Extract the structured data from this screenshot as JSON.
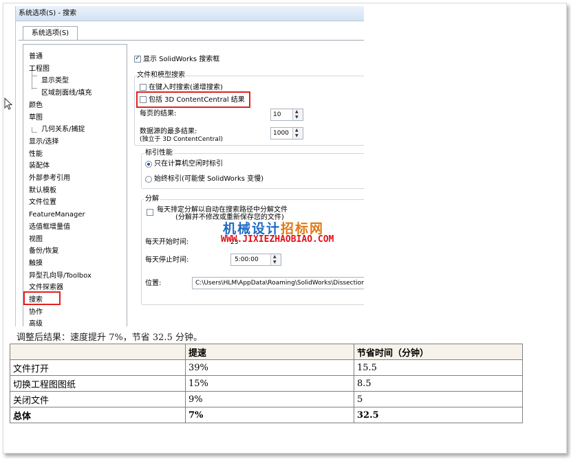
{
  "dialog": {
    "title": "系统选项(S) - 搜索",
    "tab_label": "系统选项(S)",
    "tree": [
      {
        "label": "普通",
        "level": 0
      },
      {
        "label": "工程图",
        "level": 0
      },
      {
        "label": "显示类型",
        "level": 1
      },
      {
        "label": "区域剖面线/填充",
        "level": 1
      },
      {
        "label": "颜色",
        "level": 0
      },
      {
        "label": "草图",
        "level": 0
      },
      {
        "label": "几何关系/捕捉",
        "level": 1
      },
      {
        "label": "显示/选择",
        "level": 0
      },
      {
        "label": "性能",
        "level": 0
      },
      {
        "label": "装配体",
        "level": 0
      },
      {
        "label": "外部参考引用",
        "level": 0
      },
      {
        "label": "默认模板",
        "level": 0
      },
      {
        "label": "文件位置",
        "level": 0
      },
      {
        "label": "FeatureManager",
        "level": 0
      },
      {
        "label": "选值框增量值",
        "level": 0
      },
      {
        "label": "视图",
        "level": 0
      },
      {
        "label": "备份/恢复",
        "level": 0
      },
      {
        "label": "触摸",
        "level": 0
      },
      {
        "label": "异型孔向导/Toolbox",
        "level": 0
      },
      {
        "label": "文件探索器",
        "level": 0
      },
      {
        "label": "搜索",
        "level": 0,
        "selected": true
      },
      {
        "label": "协作",
        "level": 0
      },
      {
        "label": "高级",
        "level": 0
      }
    ],
    "show_search_box": {
      "label": "显示 SolidWorks 搜索框",
      "checked": true
    },
    "file_model_search": {
      "title": "文件和模型搜索",
      "search_while_typing": {
        "label": "在键入时搜索(递增搜索)",
        "checked": false
      },
      "include_3d_content": {
        "label": "包括 3D ContentCentral 结果",
        "checked": false
      },
      "results_per_page": {
        "label": "每页的结果:",
        "value": "10"
      },
      "max_results": {
        "label": "数据源的最多结果:",
        "sublabel": "(独立于 3D ContentCentral)",
        "value": "1000"
      }
    },
    "index_performance": {
      "title": "标引性能",
      "options": [
        {
          "label": "只在计算机空闲时标引",
          "selected": true
        },
        {
          "label": "始终标引(可能使 SolidWorks 变慢)",
          "selected": false
        }
      ]
    },
    "decompose": {
      "title": "分解",
      "schedule": {
        "label": "每天排定分解以自动在搜索路径中分解文件",
        "sublabel": "(分解并不修改或重新保存您的文件)",
        "checked": false
      },
      "start_time": {
        "label": "每天开始时间:",
        "value": "23"
      },
      "stop_time": {
        "label": "每天停止时间:",
        "value": "5:00:00"
      },
      "location": {
        "label": "位置:",
        "value": "C:\\Users\\HLM\\AppData\\Roaming\\SolidWorks\\Dissection"
      }
    }
  },
  "watermark": {
    "line1_a": "机械设计",
    "line1_b": "招标网",
    "line2": "WWW.JIXIEZHAOBIAO.COM"
  },
  "caption": "调整后结果：速度提升 7%，节省 32.5 分钟。",
  "results_table": {
    "headers": [
      "",
      "提速",
      "节省时间（分钟）"
    ],
    "rows": [
      [
        "文件打开",
        "39%",
        "15.5"
      ],
      [
        "切换工程图图纸",
        "15%",
        "8.5"
      ],
      [
        "关闭文件",
        "9%",
        "5"
      ]
    ],
    "total": [
      "总体",
      "7%",
      "32.5"
    ]
  }
}
